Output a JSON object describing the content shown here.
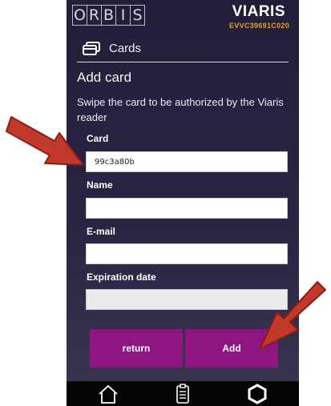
{
  "header": {
    "logo_letters": [
      "O",
      "R",
      "B",
      "I",
      "S"
    ],
    "brand": "VIARIS",
    "serial": "EVVC39691C020"
  },
  "section": {
    "icon": "card-icon",
    "label": "Cards"
  },
  "form": {
    "title": "Add card",
    "description": "Swipe the card to be authorized by the Viaris reader",
    "fields": [
      {
        "label": "Card",
        "value": "99c3a80b",
        "placeholder": ""
      },
      {
        "label": "Name",
        "value": "",
        "placeholder": ""
      },
      {
        "label": "E-mail",
        "value": "",
        "placeholder": ""
      },
      {
        "label": "Expiration date",
        "value": "",
        "placeholder": ""
      }
    ],
    "return_label": "return",
    "add_label": "Add"
  },
  "navbar": {
    "icons": [
      "home-icon",
      "document-icon",
      "settings-icon"
    ]
  },
  "colors": {
    "accent": "#8f1582",
    "serial": "#e0a21f",
    "arrow": "#c0392b"
  }
}
